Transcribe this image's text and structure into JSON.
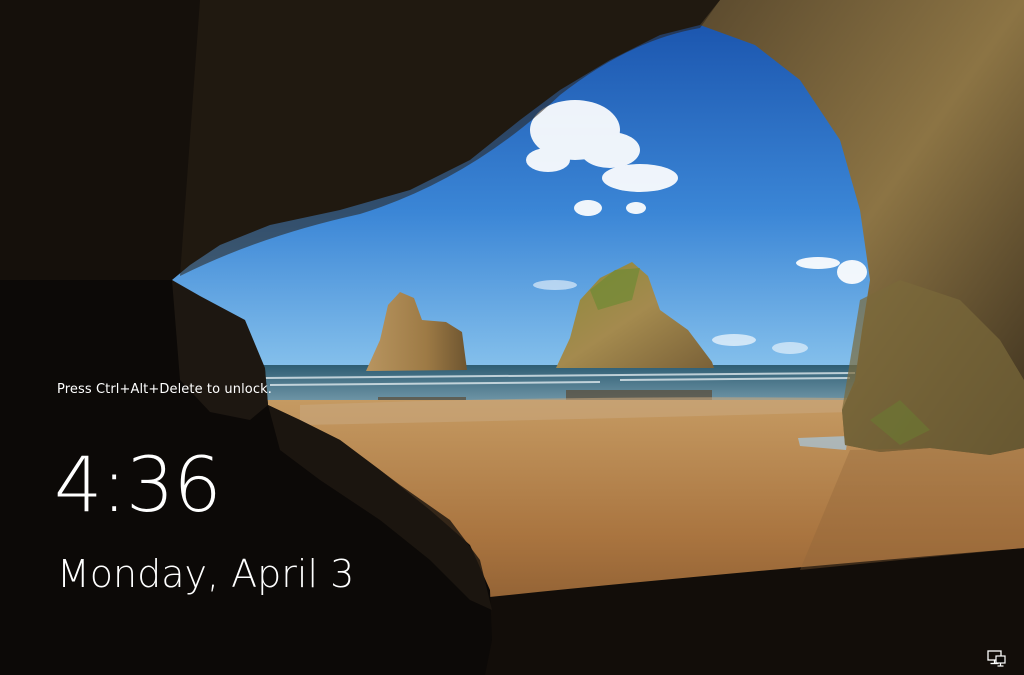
{
  "lock_screen": {
    "unlock_hint": "Press Ctrl+Alt+Delete to unlock.",
    "time": "4:36",
    "date": "Monday, April 3"
  },
  "tray": {
    "network_icon": "network-monitor-icon"
  },
  "colors": {
    "sky_top": "#1f5cb4",
    "sky_horizon": "#6fb2e8",
    "sea": "#3f6f86",
    "sand": "#b9834a",
    "cave_rock": "#2a231b",
    "text": "#ffffff"
  }
}
